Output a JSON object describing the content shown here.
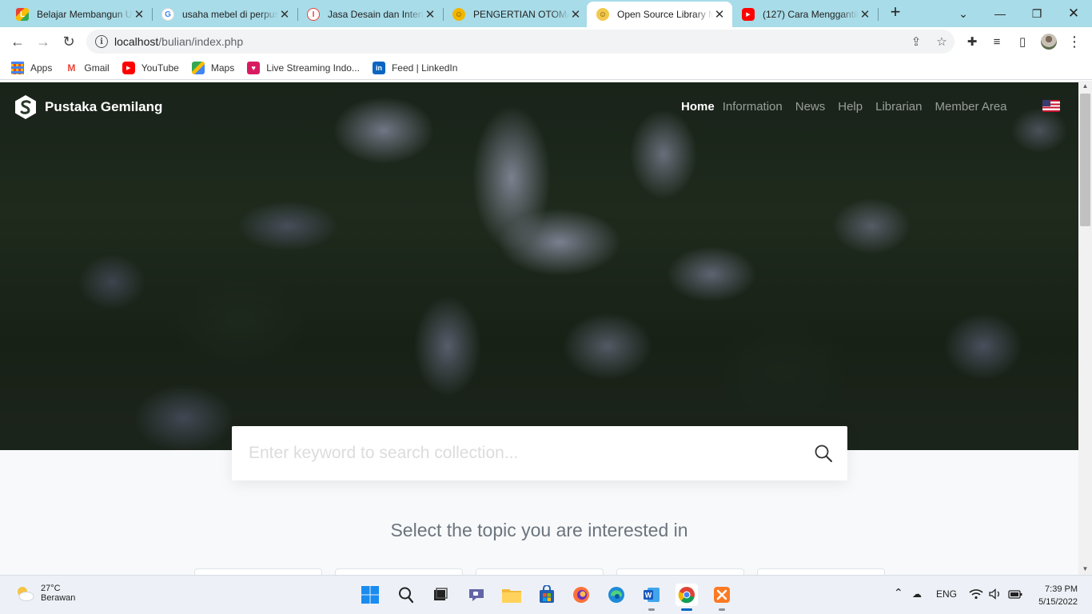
{
  "browser": {
    "tabs": [
      {
        "title": "Belajar Membangun U",
        "favicon": "multicolor-l-icon",
        "color": "#e94235"
      },
      {
        "title": "usaha mebel di perpus",
        "favicon": "google-g-icon",
        "color": "#4285f4"
      },
      {
        "title": "Jasa Desain dan Interio",
        "favicon": "site-icon",
        "color": "#e8453c"
      },
      {
        "title": "PENGERTIAN OTOMAS",
        "favicon": "smiley-icon",
        "color": "#f2b600"
      },
      {
        "title": "Open Source Library M",
        "favicon": "smiley-icon",
        "color": "#f2c94c",
        "active": true
      },
      {
        "title": "(127) Cara Menggantik",
        "favicon": "youtube-icon",
        "color": "#ff0000"
      }
    ],
    "url_host": "localhost",
    "url_path": "/bulian/index.php",
    "bookmarks": [
      {
        "label": "Apps",
        "icon": "apps-grid-icon"
      },
      {
        "label": "Gmail",
        "icon": "gmail-icon"
      },
      {
        "label": "YouTube",
        "icon": "youtube-icon"
      },
      {
        "label": "Maps",
        "icon": "maps-icon"
      },
      {
        "label": "Live Streaming Indo...",
        "icon": "streaming-icon"
      },
      {
        "label": "Feed | LinkedIn",
        "icon": "linkedin-icon"
      }
    ]
  },
  "site": {
    "brand": "Pustaka Gemilang",
    "nav": [
      "Home",
      "Information",
      "News",
      "Help",
      "Librarian",
      "Member Area"
    ],
    "search_placeholder": "Enter keyword to search collection...",
    "topic_heading": "Select the topic you are interested in",
    "topic_cards_visible": 5
  },
  "taskbar": {
    "temperature": "27°C",
    "weather": "Berawan",
    "language": "ENG",
    "time": "7:39 PM",
    "date": "5/15/2022"
  },
  "colors": {
    "tabstrip": "#a8dce8",
    "page_bg": "#f7f9fb",
    "taskbar": "#edf1f7"
  }
}
